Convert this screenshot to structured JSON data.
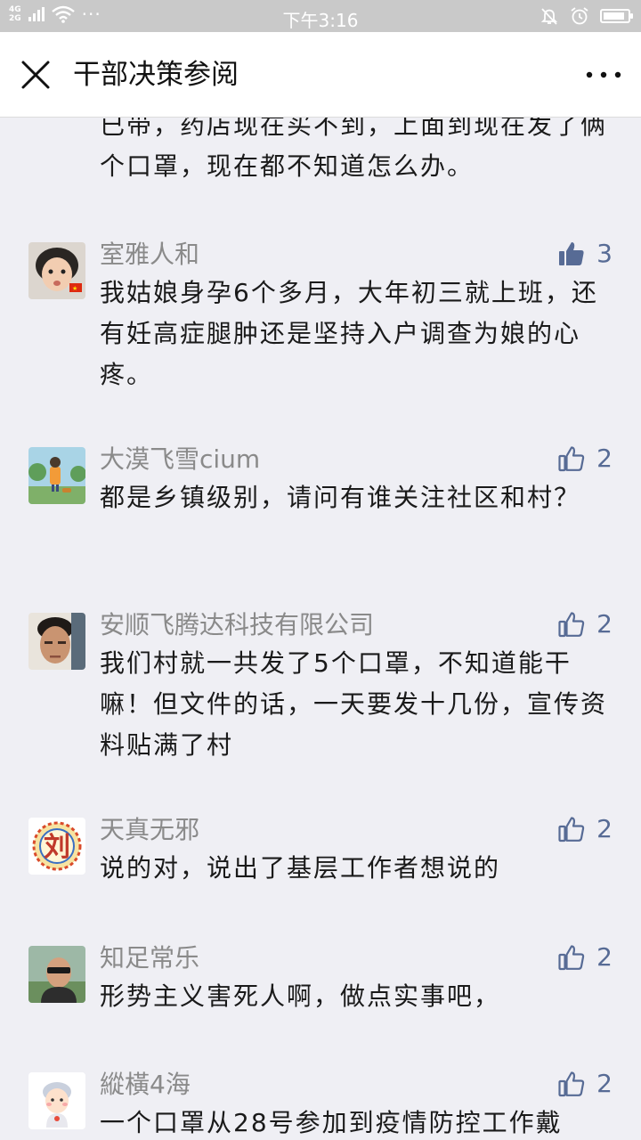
{
  "status_bar": {
    "network_top": "4G",
    "network_bottom": "2G",
    "dots": "···",
    "time": "下午3:16",
    "battery_level": 0.9
  },
  "header": {
    "title": "干部决策参阅"
  },
  "truncated_comment": {
    "text": "已带，药店现在买不到，上面到现在发了俩个口罩，现在都不知道怎么办。"
  },
  "comments": [
    {
      "name": "室雅人和",
      "text": "我姑娘身孕6个多月，大年初三就上班，还有妊高症腿肿还是坚持入户调查为娘的心疼。",
      "likes": "3",
      "liked": true,
      "avatar": "child-avatar"
    },
    {
      "name": "大漠飞雪cium",
      "text": "都是乡镇级别，请问有谁关注社区和村？",
      "likes": "2",
      "liked": false,
      "avatar": "landscape-avatar"
    },
    {
      "name": "安顺飞腾达科技有限公司",
      "text": "我们村就一共发了5个口罩，不知道能干嘛！但文件的话，一天要发十几份，宣传资料贴满了村",
      "likes": "2",
      "liked": false,
      "avatar": "man-avatar"
    },
    {
      "name": "天真无邪",
      "text": "说的对，说出了基层工作者想说的",
      "likes": "2",
      "liked": false,
      "avatar": "liu-seal-avatar",
      "avatar_char": "刘"
    },
    {
      "name": "知足常乐",
      "text": "形势主义害死人啊，做点实事吧，",
      "likes": "2",
      "liked": false,
      "avatar": "sunglasses-avatar"
    },
    {
      "name": "縱橫4海",
      "text": "一个口罩从28号参加到疫情防控工作戴",
      "likes": "2",
      "liked": false,
      "avatar": "cartoon-avatar"
    }
  ],
  "colors": {
    "like_blue": "#576b95",
    "name_gray": "#8a8a8a",
    "background": "#efeff4"
  }
}
